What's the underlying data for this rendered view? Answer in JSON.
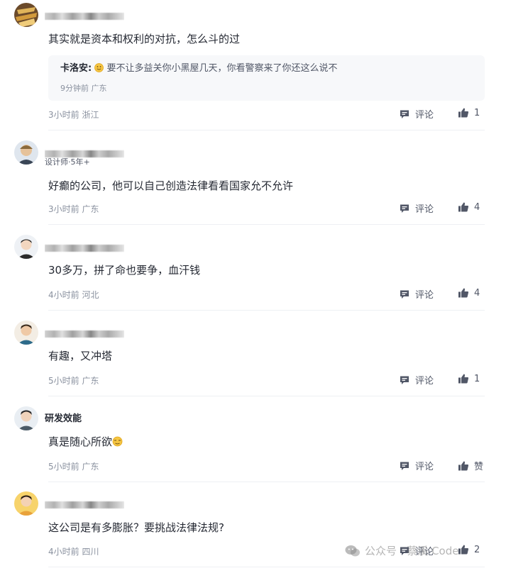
{
  "colors": {
    "text_primary": "#252933",
    "text_secondary": "#515767",
    "text_meta": "#8a919f",
    "reply_background": "#f7f8fa",
    "divider": "#eef0f3"
  },
  "comments": [
    {
      "username": "",
      "text": "其实就是资本和权利的对抗，怎么斗的过",
      "reply": {
        "author": "卡洛安:",
        "emoji": "smile-emoji-icon",
        "text": "要不让多益关你小黑屋几天，你看警察来了你还这么说不",
        "meta": "9分钟前 广东"
      },
      "meta": "3小时前 浙江",
      "comment_label": "评论",
      "likes": "1"
    },
    {
      "username": "",
      "title": "设计师·5年+",
      "text": "好癫的公司，他可以自己创造法律看看国家允不允许",
      "meta": "3小时前 广东",
      "comment_label": "评论",
      "likes": "4"
    },
    {
      "username": "",
      "text": "30多万，拼了命也要争，血汗钱",
      "meta": "4小时前 河北",
      "comment_label": "评论",
      "likes": "4"
    },
    {
      "username": "",
      "text": "有趣，又冲塔",
      "meta": "5小时前 广东",
      "comment_label": "评论",
      "likes": "1"
    },
    {
      "username": "研发效能",
      "text": "真是随心所欲",
      "meta": "5小时前 广东",
      "comment_label": "评论",
      "likes": "赞"
    },
    {
      "username": "",
      "text": "这公司是有多膨胀？要挑战法律法规?",
      "meta": "4小时前 四川",
      "comment_label": "评论",
      "likes": "2"
    }
  ],
  "watermark": {
    "text": "公众号 · 蔡溪 Code",
    "icon": "wechat-icon"
  }
}
